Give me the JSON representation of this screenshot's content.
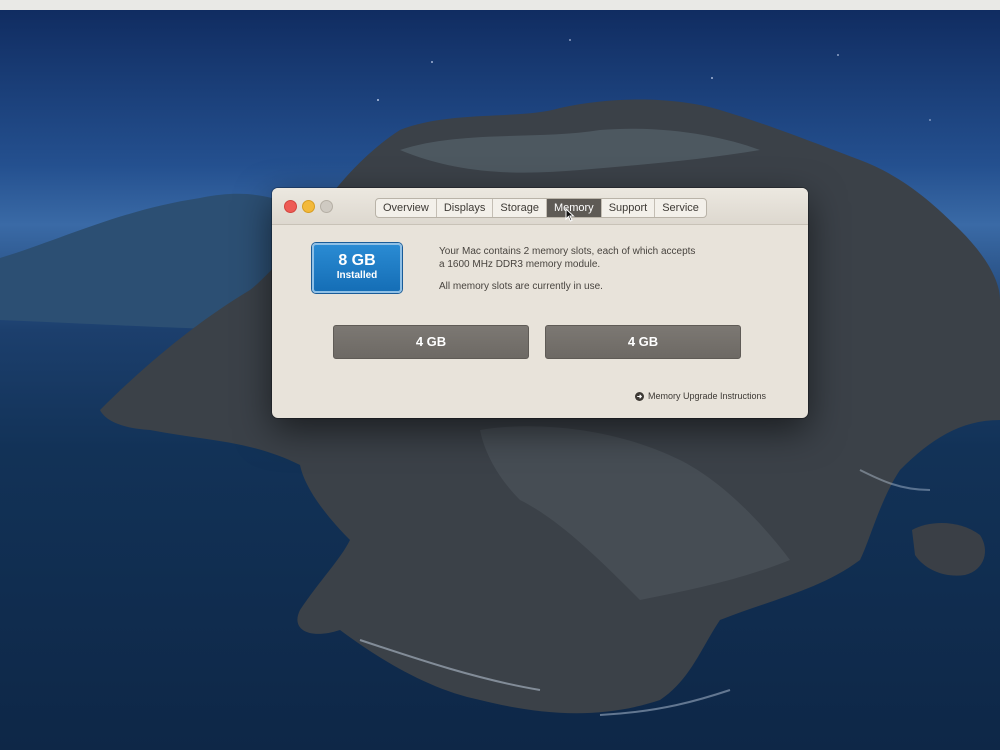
{
  "window": {
    "tabs": [
      {
        "label": "Overview",
        "active": false
      },
      {
        "label": "Displays",
        "active": false
      },
      {
        "label": "Storage",
        "active": false
      },
      {
        "label": "Memory",
        "active": true
      },
      {
        "label": "Support",
        "active": false
      },
      {
        "label": "Service",
        "active": false
      }
    ]
  },
  "memory": {
    "installed_size": "8 GB",
    "installed_label": "Installed",
    "description_line1": "Your Mac contains 2 memory slots, each of which accepts",
    "description_line2": "a 1600 MHz DDR3 memory module.",
    "status": "All memory slots are currently in use.",
    "slots": [
      {
        "label": "4 GB"
      },
      {
        "label": "4 GB"
      }
    ],
    "upgrade_link": "Memory Upgrade Instructions"
  },
  "colors": {
    "installed_badge": "#1a7cc4",
    "active_tab": "#5e5a55",
    "slot": "#75716c",
    "close": "#ee5b55",
    "minimize": "#f3b93a"
  }
}
